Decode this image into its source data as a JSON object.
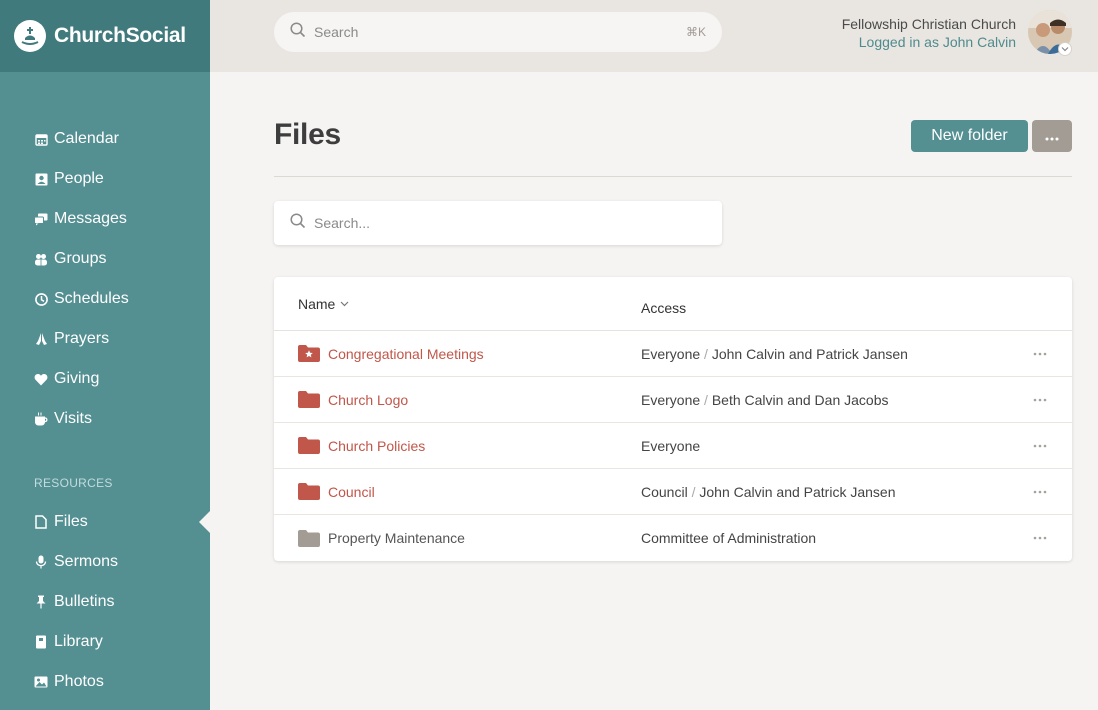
{
  "brand": {
    "name": "ChurchSocial",
    "accent": "#548f92",
    "accent_dark": "#417a7d",
    "link_color": "#c1564a"
  },
  "sidebar": {
    "main_items": [
      {
        "label": "Calendar",
        "icon": "calendar-icon"
      },
      {
        "label": "People",
        "icon": "person-card-icon"
      },
      {
        "label": "Messages",
        "icon": "chat-bubbles-icon"
      },
      {
        "label": "Groups",
        "icon": "group-icon"
      },
      {
        "label": "Schedules",
        "icon": "clock-icon"
      },
      {
        "label": "Prayers",
        "icon": "praying-hands-icon"
      },
      {
        "label": "Giving",
        "icon": "heart-icon"
      },
      {
        "label": "Visits",
        "icon": "coffee-cup-icon"
      }
    ],
    "section_label": "RESOURCES",
    "resource_items": [
      {
        "label": "Files",
        "icon": "file-icon",
        "active": true
      },
      {
        "label": "Sermons",
        "icon": "microphone-icon"
      },
      {
        "label": "Bulletins",
        "icon": "pushpin-icon"
      },
      {
        "label": "Library",
        "icon": "book-icon"
      },
      {
        "label": "Photos",
        "icon": "photo-icon"
      }
    ]
  },
  "topbar": {
    "search_placeholder": "Search",
    "shortcut": "⌘K",
    "org_name": "Fellowship Christian Church",
    "logged_in": "Logged in as John Calvin"
  },
  "page": {
    "title": "Files",
    "new_folder_label": "New folder",
    "filter_placeholder": "Search..."
  },
  "table": {
    "columns": {
      "name": "Name",
      "access": "Access"
    },
    "rows": [
      {
        "name": "Congregational Meetings",
        "access_main": "Everyone",
        "access_sep": "/",
        "access_sub": "John Calvin and Patrick Jansen",
        "folder_color": "#c1564a",
        "starred": true
      },
      {
        "name": "Church Logo",
        "access_main": "Everyone",
        "access_sep": "/",
        "access_sub": "Beth Calvin and Dan Jacobs",
        "folder_color": "#c1564a"
      },
      {
        "name": "Church Policies",
        "access_main": "Everyone",
        "access_sep": "",
        "access_sub": "",
        "folder_color": "#c1564a"
      },
      {
        "name": "Council",
        "access_main": "Council",
        "access_sep": "/",
        "access_sub": "John Calvin and Patrick Jansen",
        "folder_color": "#c1564a"
      },
      {
        "name": "Property Maintenance",
        "access_main": "Committee of Administration",
        "access_sep": "",
        "access_sub": "",
        "folder_color": "#a39c94",
        "muted": true
      }
    ]
  }
}
